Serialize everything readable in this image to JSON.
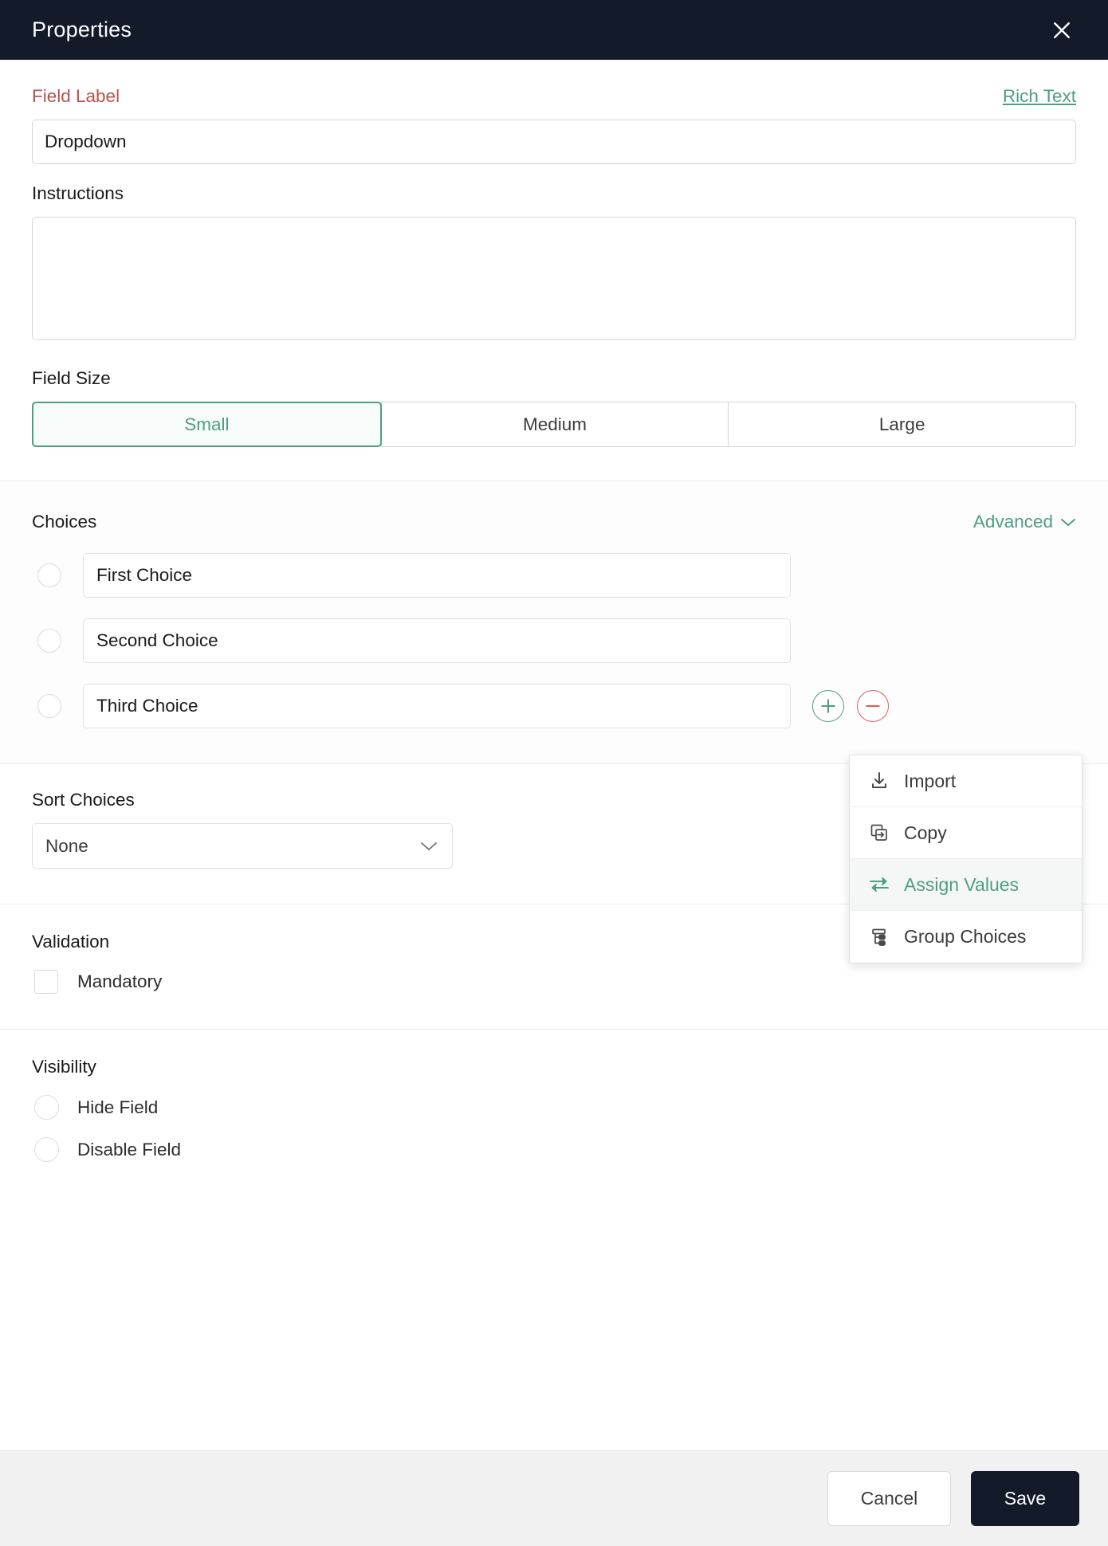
{
  "header": {
    "title": "Properties",
    "close_icon": "close-icon"
  },
  "field_label": {
    "label": "Field Label",
    "rich_text_link": "Rich Text",
    "value": "Dropdown"
  },
  "instructions": {
    "label": "Instructions",
    "value": ""
  },
  "field_size": {
    "label": "Field Size",
    "options": [
      {
        "label": "Small",
        "selected": true
      },
      {
        "label": "Medium",
        "selected": false
      },
      {
        "label": "Large",
        "selected": false
      }
    ]
  },
  "choices": {
    "label": "Choices",
    "advanced_label": "Advanced",
    "advanced_chevron_icon": "chevron-down-icon",
    "items": [
      {
        "value": "First Choice"
      },
      {
        "value": "Second Choice"
      },
      {
        "value": "Third Choice"
      }
    ],
    "add_button_label": "+",
    "remove_button_label": "-"
  },
  "advanced_menu": {
    "items": [
      {
        "label": "Import",
        "icon": "import-icon",
        "hovered": false
      },
      {
        "label": "Copy",
        "icon": "copy-icon",
        "hovered": false
      },
      {
        "label": "Assign Values",
        "icon": "assign-values-icon",
        "hovered": true
      },
      {
        "label": "Group Choices",
        "icon": "group-choices-icon",
        "hovered": false
      }
    ]
  },
  "sort_choices": {
    "label": "Sort Choices",
    "value": "None",
    "chevron_icon": "chevron-down-icon"
  },
  "validation": {
    "label": "Validation",
    "mandatory_label": "Mandatory",
    "mandatory_checked": false
  },
  "visibility": {
    "label": "Visibility",
    "options": [
      {
        "label": "Hide Field",
        "selected": false
      },
      {
        "label": "Disable Field",
        "selected": false
      }
    ]
  },
  "footer": {
    "cancel_label": "Cancel",
    "save_label": "Save"
  },
  "colors": {
    "header_bg": "#131a2a",
    "accent_teal": "#4e9e82",
    "required_red": "#b5544c",
    "danger_red": "#e35b57",
    "footer_bg": "#f1f1f1"
  }
}
